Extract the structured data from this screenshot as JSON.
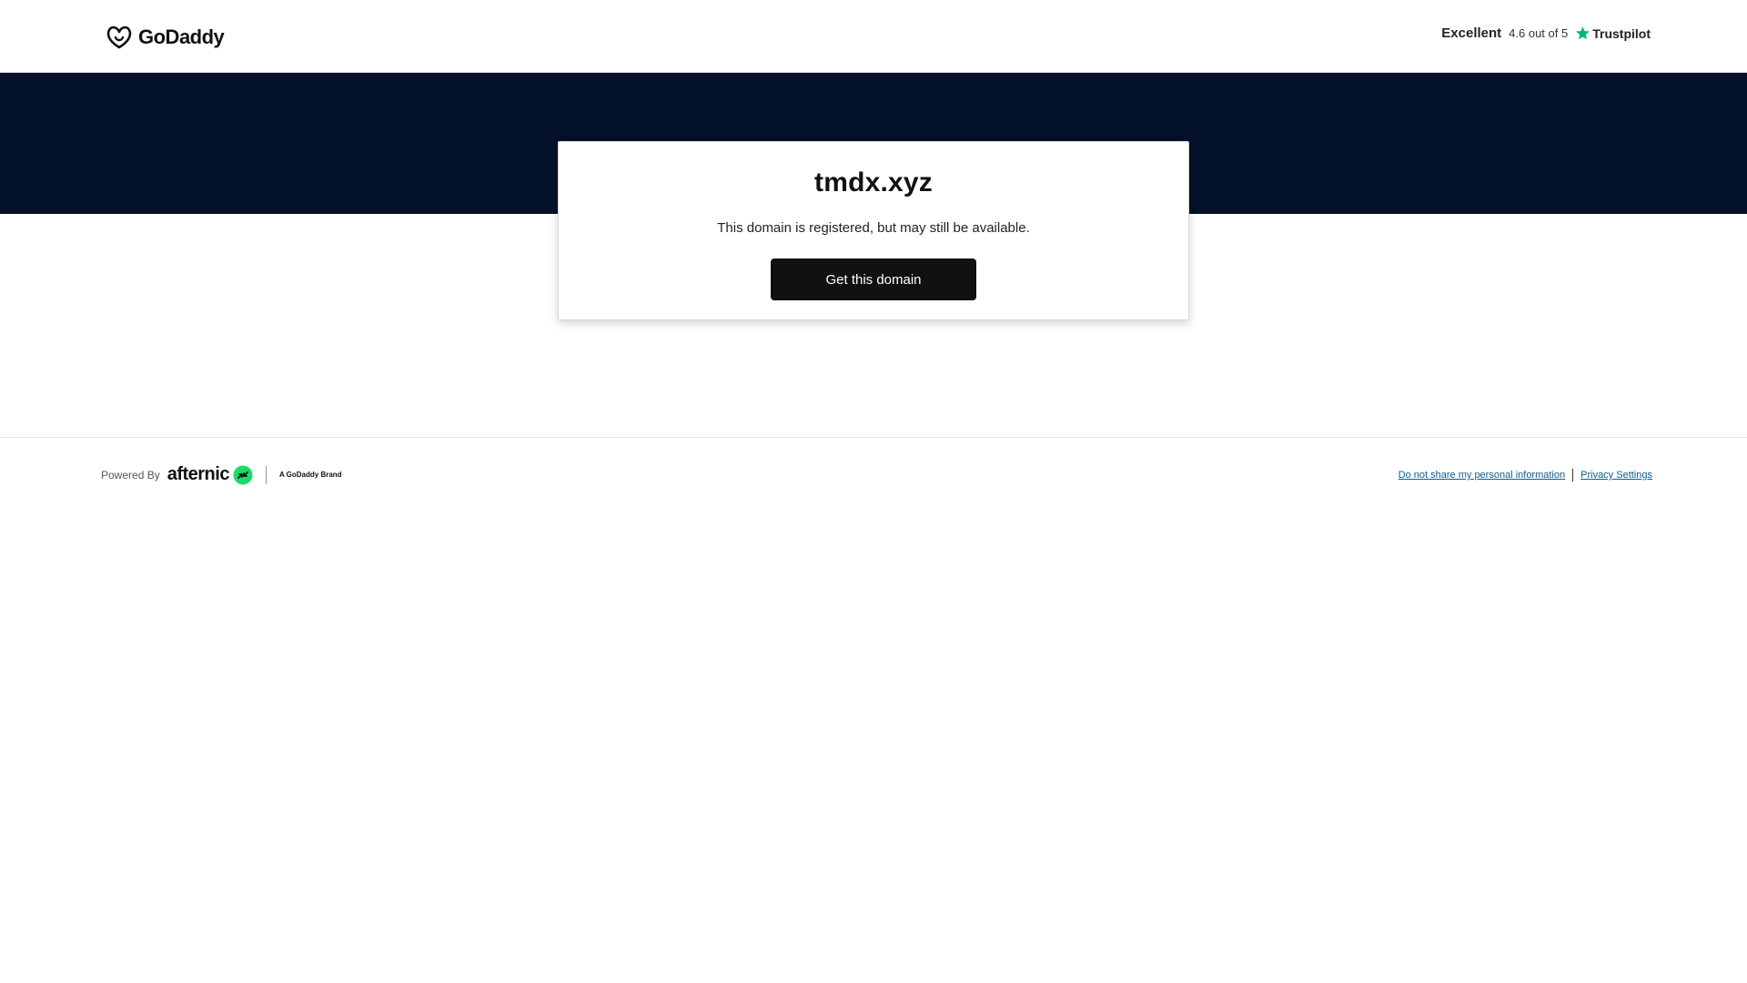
{
  "header": {
    "logo_text": "GoDaddy",
    "rating": {
      "word": "Excellent",
      "score": "4.6 out of 5",
      "provider": "Trustpilot"
    }
  },
  "card": {
    "domain": "tmdx.xyz",
    "status": "This domain is registered, but may still be available.",
    "cta_label": "Get this domain"
  },
  "footer": {
    "powered_label": "Powered By",
    "brand_name": "afternic",
    "brand_tag": "A GoDaddy Brand",
    "links": {
      "do_not_share": "Do not share my personal information",
      "privacy": "Privacy Settings"
    }
  },
  "colors": {
    "hero_bg": "#03112b",
    "cta_bg": "#111111",
    "afternic_green": "#1bdb6a",
    "trustpilot_green": "#00b67a",
    "link": "#0a5e8e"
  }
}
